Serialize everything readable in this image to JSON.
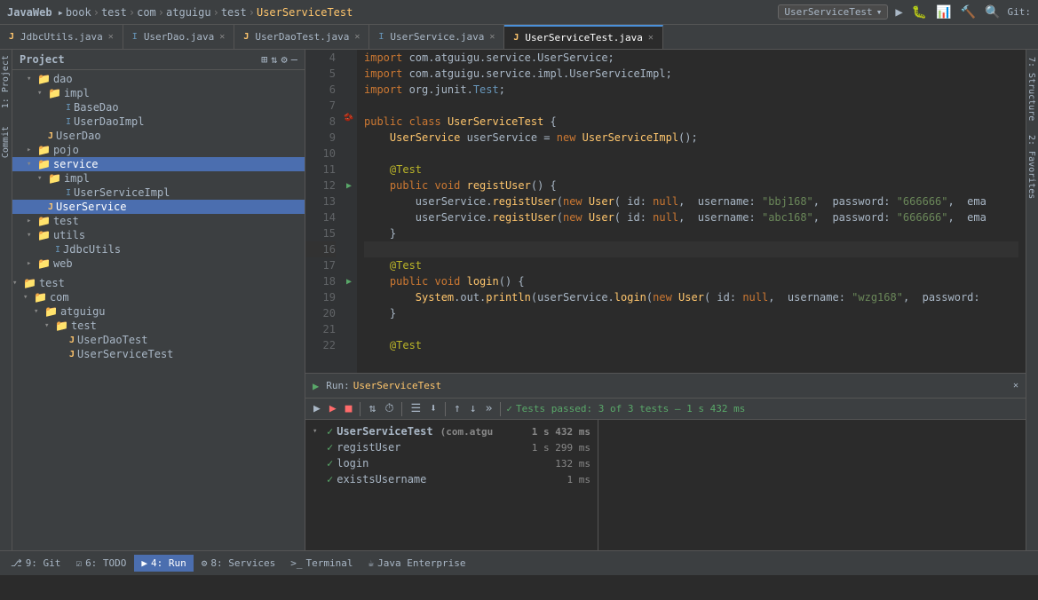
{
  "topbar": {
    "brand": "JavaWeb",
    "breadcrumbs": [
      "book",
      "test",
      "com",
      "atguigu",
      "test"
    ],
    "active_file": "UserServiceTest",
    "run_config": "UserServiceTest",
    "git_label": "Git:"
  },
  "tabs": [
    {
      "label": "JdbcUtils.java",
      "icon": "J",
      "active": false,
      "closable": true
    },
    {
      "label": "UserDao.java",
      "icon": "I",
      "active": false,
      "closable": true
    },
    {
      "label": "UserDaoTest.java",
      "icon": "J",
      "active": false,
      "closable": true
    },
    {
      "label": "UserService.java",
      "icon": "I",
      "active": false,
      "closable": true
    },
    {
      "label": "UserServiceTest.java",
      "icon": "J",
      "active": true,
      "closable": true
    }
  ],
  "project_panel": {
    "title": "Project",
    "tree": [
      {
        "indent": 2,
        "type": "folder",
        "label": "dao",
        "expanded": true
      },
      {
        "indent": 4,
        "type": "folder",
        "label": "impl",
        "expanded": true
      },
      {
        "indent": 6,
        "type": "file_i",
        "label": "BaseDao"
      },
      {
        "indent": 6,
        "type": "file_i",
        "label": "UserDaoImpl"
      },
      {
        "indent": 4,
        "type": "file_j",
        "label": "UserDao"
      },
      {
        "indent": 2,
        "type": "folder",
        "label": "pojo",
        "expanded": false
      },
      {
        "indent": 2,
        "type": "folder_selected",
        "label": "service",
        "expanded": true
      },
      {
        "indent": 4,
        "type": "folder",
        "label": "impl",
        "expanded": true
      },
      {
        "indent": 6,
        "type": "file_i",
        "label": "UserServiceImpl"
      },
      {
        "indent": 4,
        "type": "file_j_selected",
        "label": "UserService"
      },
      {
        "indent": 2,
        "type": "folder",
        "label": "test",
        "expanded": false
      },
      {
        "indent": 2,
        "type": "folder",
        "label": "utils",
        "expanded": true
      },
      {
        "indent": 4,
        "type": "file_i",
        "label": "JdbcUtils"
      },
      {
        "indent": 2,
        "type": "folder",
        "label": "web",
        "expanded": false
      }
    ],
    "tree2": [
      {
        "indent": 0,
        "type": "folder",
        "label": "test",
        "expanded": true
      },
      {
        "indent": 2,
        "type": "folder",
        "label": "com",
        "expanded": true
      },
      {
        "indent": 4,
        "type": "folder",
        "label": "atguigu",
        "expanded": true
      },
      {
        "indent": 6,
        "type": "folder",
        "label": "test",
        "expanded": true
      },
      {
        "indent": 8,
        "type": "file_j",
        "label": "UserDaoTest"
      },
      {
        "indent": 8,
        "type": "file_j",
        "label": "UserServiceTest"
      }
    ]
  },
  "code": {
    "lines": [
      {
        "num": 4,
        "tokens": [
          {
            "t": "import ",
            "c": "plain"
          },
          {
            "t": "com.atguigu.service.UserService",
            "c": "plain"
          },
          {
            "t": ";",
            "c": "plain"
          }
        ]
      },
      {
        "num": 5,
        "tokens": [
          {
            "t": "import ",
            "c": "plain"
          },
          {
            "t": "com.atguigu.service.impl.UserServiceImpl",
            "c": "plain"
          },
          {
            "t": ";",
            "c": "plain"
          }
        ]
      },
      {
        "num": 6,
        "tokens": [
          {
            "t": "import ",
            "c": "plain"
          },
          {
            "t": "org.junit.Test",
            "c": "plain"
          },
          {
            "t": ";",
            "c": "plain"
          }
        ]
      },
      {
        "num": 7,
        "tokens": []
      },
      {
        "num": 8,
        "tokens": [
          {
            "t": "public ",
            "c": "kw"
          },
          {
            "t": "class ",
            "c": "kw"
          },
          {
            "t": "UserServiceTest ",
            "c": "type"
          },
          {
            "t": "{",
            "c": "plain"
          }
        ],
        "gutter": "bean"
      },
      {
        "num": 9,
        "tokens": [
          {
            "t": "    ",
            "c": "plain"
          },
          {
            "t": "UserService",
            "c": "type"
          },
          {
            "t": " userService = ",
            "c": "plain"
          },
          {
            "t": "new ",
            "c": "kw"
          },
          {
            "t": "UserServiceImpl",
            "c": "type"
          },
          {
            "t": "();",
            "c": "plain"
          }
        ]
      },
      {
        "num": 10,
        "tokens": []
      },
      {
        "num": 11,
        "tokens": [
          {
            "t": "    ",
            "c": "plain"
          },
          {
            "t": "@Test",
            "c": "ann"
          }
        ]
      },
      {
        "num": 12,
        "tokens": [
          {
            "t": "    ",
            "c": "plain"
          },
          {
            "t": "public ",
            "c": "kw"
          },
          {
            "t": "void ",
            "c": "kw"
          },
          {
            "t": "registUser",
            "c": "fn"
          },
          {
            "t": "() {",
            "c": "plain"
          }
        ],
        "gutter": "run"
      },
      {
        "num": 13,
        "tokens": [
          {
            "t": "        ",
            "c": "plain"
          },
          {
            "t": "userService",
            "c": "plain"
          },
          {
            "t": ".",
            "c": "plain"
          },
          {
            "t": "registUser",
            "c": "method-call"
          },
          {
            "t": "(",
            "c": "plain"
          },
          {
            "t": "new ",
            "c": "kw"
          },
          {
            "t": "User",
            "c": "type"
          },
          {
            "t": "( id: ",
            "c": "plain"
          },
          {
            "t": "null",
            "c": "kw"
          },
          {
            "t": ",  username: ",
            "c": "plain"
          },
          {
            "t": "\"bbj168\"",
            "c": "str"
          },
          {
            "t": ",  password: ",
            "c": "plain"
          },
          {
            "t": "\"666666\"",
            "c": "str"
          },
          {
            "t": ",  ema",
            "c": "plain"
          }
        ]
      },
      {
        "num": 14,
        "tokens": [
          {
            "t": "        ",
            "c": "plain"
          },
          {
            "t": "userService",
            "c": "plain"
          },
          {
            "t": ".",
            "c": "plain"
          },
          {
            "t": "registUser",
            "c": "method-call"
          },
          {
            "t": "(",
            "c": "plain"
          },
          {
            "t": "new ",
            "c": "kw"
          },
          {
            "t": "User",
            "c": "type"
          },
          {
            "t": "( id: ",
            "c": "plain"
          },
          {
            "t": "null",
            "c": "kw"
          },
          {
            "t": ",  username: ",
            "c": "plain"
          },
          {
            "t": "\"abc168\"",
            "c": "str"
          },
          {
            "t": ",  password: ",
            "c": "plain"
          },
          {
            "t": "\"666666\"",
            "c": "str"
          },
          {
            "t": ",  ema",
            "c": "plain"
          }
        ]
      },
      {
        "num": 15,
        "tokens": [
          {
            "t": "    }",
            "c": "plain"
          }
        ]
      },
      {
        "num": 16,
        "tokens": [],
        "highlighted": true
      },
      {
        "num": 17,
        "tokens": [
          {
            "t": "    ",
            "c": "plain"
          },
          {
            "t": "@Test",
            "c": "ann"
          }
        ]
      },
      {
        "num": 18,
        "tokens": [
          {
            "t": "    ",
            "c": "plain"
          },
          {
            "t": "public ",
            "c": "kw"
          },
          {
            "t": "void ",
            "c": "kw"
          },
          {
            "t": "login",
            "c": "fn"
          },
          {
            "t": "() {",
            "c": "plain"
          }
        ],
        "gutter": "run"
      },
      {
        "num": 19,
        "tokens": [
          {
            "t": "        ",
            "c": "plain"
          },
          {
            "t": "System",
            "c": "type"
          },
          {
            "t": ".out.",
            "c": "plain"
          },
          {
            "t": "println",
            "c": "method-call"
          },
          {
            "t": "(",
            "c": "plain"
          },
          {
            "t": "userService",
            "c": "plain"
          },
          {
            "t": ".",
            "c": "plain"
          },
          {
            "t": "login",
            "c": "method-call"
          },
          {
            "t": "(",
            "c": "plain"
          },
          {
            "t": "new ",
            "c": "kw"
          },
          {
            "t": "User",
            "c": "type"
          },
          {
            "t": "( id: ",
            "c": "plain"
          },
          {
            "t": "null",
            "c": "kw"
          },
          {
            "t": ",  username: ",
            "c": "plain"
          },
          {
            "t": "\"wzg168\"",
            "c": "str"
          },
          {
            "t": ",  password:",
            "c": "plain"
          }
        ]
      },
      {
        "num": 20,
        "tokens": [
          {
            "t": "    }",
            "c": "plain"
          }
        ]
      },
      {
        "num": 21,
        "tokens": []
      },
      {
        "num": 22,
        "tokens": [
          {
            "t": "    ",
            "c": "plain"
          },
          {
            "t": "@Test",
            "c": "ann"
          }
        ]
      }
    ]
  },
  "run_panel": {
    "title": "Run:",
    "config": "UserServiceTest",
    "status": "Tests passed: 3 of 3 tests – 1 s 432 ms",
    "suite": {
      "label": "UserServiceTest",
      "detail": "(com.atgu",
      "time": "1 s 432 ms",
      "children": [
        {
          "label": "registUser",
          "time": "1 s 299 ms"
        },
        {
          "label": "login",
          "time": "132 ms"
        },
        {
          "label": "existsUsername",
          "time": "1 ms"
        }
      ]
    }
  },
  "bottom_bar": {
    "items": [
      {
        "label": "Git",
        "icon": "⎇",
        "active": false
      },
      {
        "label": "TODO",
        "icon": "☑",
        "active": false
      },
      {
        "label": "Run",
        "icon": "▶",
        "active": true
      },
      {
        "label": "Services",
        "icon": "⚙",
        "active": false
      },
      {
        "label": "Terminal",
        "icon": ">_",
        "active": false
      },
      {
        "label": "Java Enterprise",
        "icon": "☕",
        "active": false
      }
    ]
  },
  "side_tabs": {
    "right": [
      "Structure",
      "Favorites"
    ]
  }
}
